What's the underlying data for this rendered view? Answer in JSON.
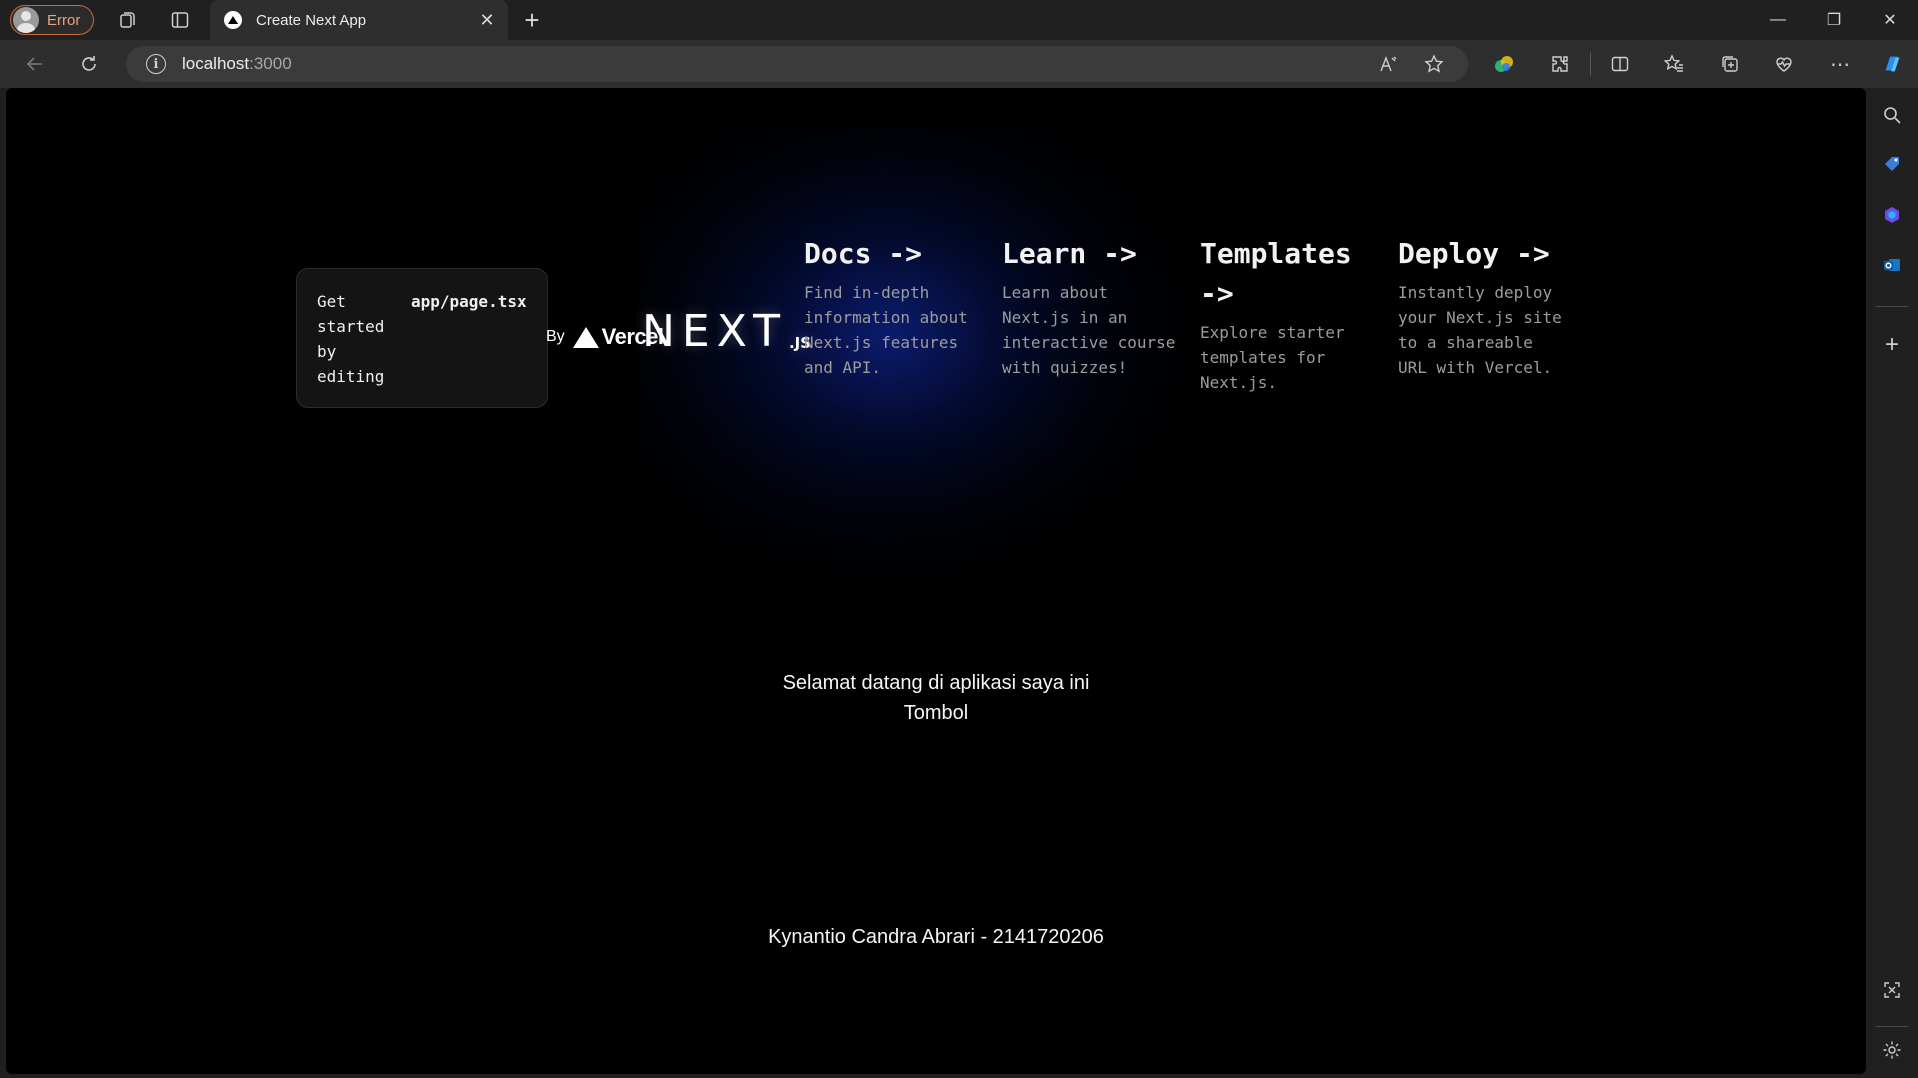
{
  "browser": {
    "profile_label": "Error",
    "tab_title": "Create Next App",
    "tab_close_glyph": "✕",
    "new_tab_glyph": "+",
    "url_host": "localhost",
    "url_port": ":3000",
    "read_aloud_glyph": "A",
    "more_glyph": "⋯",
    "window_minimize": "—",
    "window_restore": "❐",
    "window_close": "✕",
    "sidebar_add_glyph": "+"
  },
  "page": {
    "hint_text": "Get started by editing",
    "hint_code": "app/page.tsx",
    "by_label": "By",
    "vercel_word": "Vercel",
    "next_word": "NEXT",
    "next_suffix": ".JS",
    "cards": [
      {
        "title": "Docs ->",
        "description": "Find in-depth information about Next.js features and API."
      },
      {
        "title": "Learn ->",
        "description": "Learn about Next.js in an interactive course with quizzes!"
      },
      {
        "title": "Templates ->",
        "description": "Explore starter templates for Next.js."
      },
      {
        "title": "Deploy ->",
        "description": "Instantly deploy your Next.js site to a shareable URL with Vercel."
      }
    ],
    "welcome_text": "Selamat datang di aplikasi saya ini",
    "button_label": "Tombol",
    "footer_text": "Kynantio Candra Abrari - 2141720206"
  },
  "colors": {
    "page_background": "#000000",
    "glow": "#1432c8",
    "profile_border": "#c96a3a"
  },
  "icons": {
    "tabs_toolbar": [
      "workspaces-icon",
      "vertical-tabs-icon"
    ],
    "toolbar": [
      "back-icon",
      "refresh-icon",
      "site-info-icon",
      "read-aloud-icon",
      "favorite-star-icon",
      "copilot-color-icon",
      "extensions-icon",
      "split-screen-icon",
      "favorites-icon",
      "collections-icon",
      "browser-essentials-icon",
      "more-icon",
      "copilot-icon"
    ],
    "sidebar": [
      "search-icon",
      "shopping-tag-icon",
      "microsoft-365-icon",
      "outlook-icon",
      "add-icon",
      "screenshot-icon",
      "settings-icon"
    ]
  }
}
